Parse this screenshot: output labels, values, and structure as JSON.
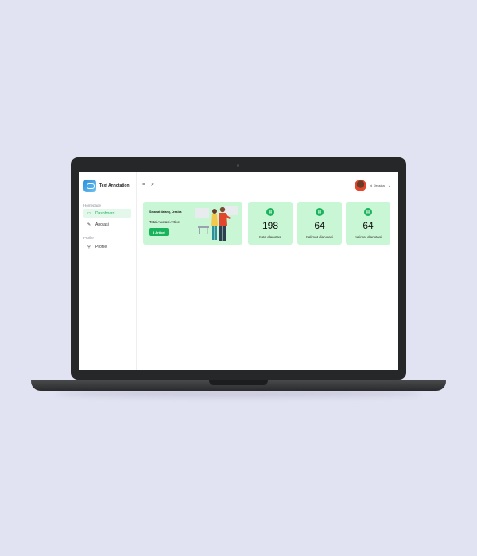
{
  "app": {
    "name": "Text Annotation"
  },
  "sidebar": {
    "sections": [
      {
        "label": "Homepage"
      },
      {
        "label": "Profile"
      }
    ],
    "items": [
      {
        "label": "Dashboard",
        "icon": "monitor-icon"
      },
      {
        "label": "Anotasi",
        "icon": "edit-icon"
      },
      {
        "label": "Profile",
        "icon": "user-icon"
      }
    ]
  },
  "header": {
    "user_name": "hi_Jessica"
  },
  "welcome": {
    "title": "Selamat datang, Jessica",
    "subtitle": "Total Anotasi Artikel",
    "button_label": "8 Artikel"
  },
  "stats": [
    {
      "value": "198",
      "label": "Kata dianotasi"
    },
    {
      "value": "64",
      "label": "Kalimat dianotasi"
    },
    {
      "value": "64",
      "label": "Kalimat dianotasi"
    }
  ],
  "colors": {
    "accent": "#18b35a",
    "card_bg": "#c9f6d4",
    "page_bg": "#e2e3f2"
  }
}
